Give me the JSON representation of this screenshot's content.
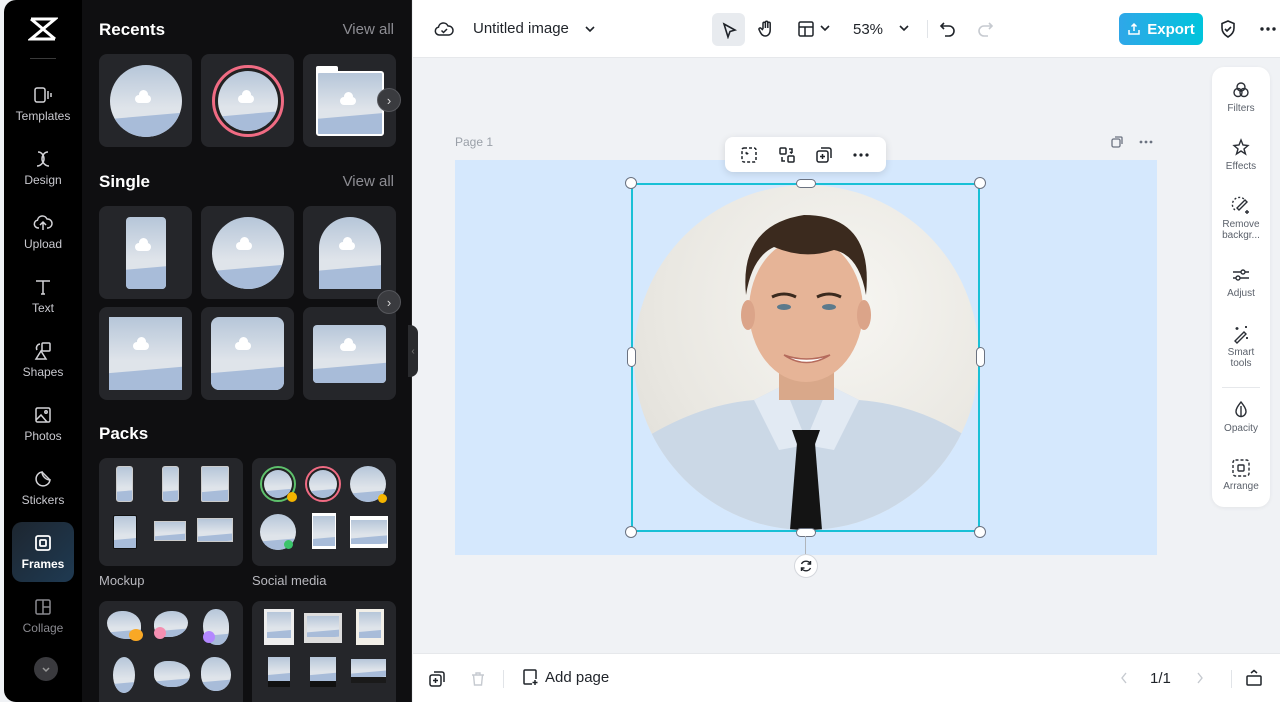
{
  "rail": {
    "items": [
      {
        "label": "Templates",
        "icon": "templates-icon"
      },
      {
        "label": "Design",
        "icon": "design-icon"
      },
      {
        "label": "Upload",
        "icon": "upload-icon"
      },
      {
        "label": "Text",
        "icon": "text-icon"
      },
      {
        "label": "Shapes",
        "icon": "shapes-icon"
      },
      {
        "label": "Photos",
        "icon": "photos-icon"
      },
      {
        "label": "Stickers",
        "icon": "stickers-icon"
      },
      {
        "label": "Frames",
        "icon": "frames-icon",
        "active": true
      },
      {
        "label": "Collage",
        "icon": "collage-icon"
      }
    ]
  },
  "panel": {
    "recents": {
      "title": "Recents",
      "view_all": "View all"
    },
    "single": {
      "title": "Single",
      "view_all": "View all"
    },
    "packs": {
      "title": "Packs",
      "items": [
        {
          "label": "Mockup"
        },
        {
          "label": "Social media"
        }
      ]
    }
  },
  "topbar": {
    "title": "Untitled image",
    "zoom": "53%",
    "export_label": "Export",
    "accent": "#19c0d6"
  },
  "canvas": {
    "page_label": "Page 1"
  },
  "tools": {
    "items": [
      {
        "label": "Filters"
      },
      {
        "label": "Effects"
      },
      {
        "label": "Remove backgr..."
      },
      {
        "label": "Adjust"
      },
      {
        "label": "Smart tools"
      },
      {
        "label": "Opacity"
      },
      {
        "label": "Arrange"
      }
    ]
  },
  "bottombar": {
    "add_page": "Add page",
    "pager": "1/1"
  }
}
